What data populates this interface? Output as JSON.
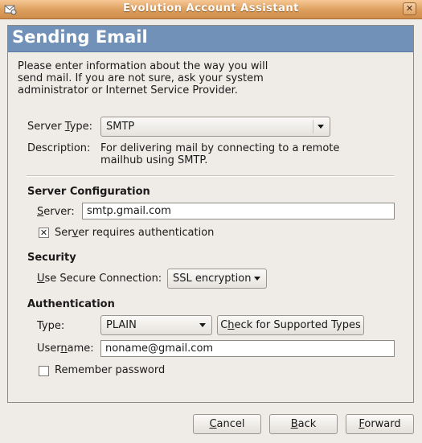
{
  "window": {
    "title": "Evolution Account Assistant",
    "close_glyph": "✕"
  },
  "page": {
    "heading": "Sending Email",
    "intro": "Please enter information about the way you will send mail. If you are not sure, ask your system administrator or Internet Service Provider."
  },
  "server_type": {
    "label_pre": "Server ",
    "label_key": "T",
    "label_post": "ype:",
    "value": "SMTP",
    "description_label": "Description:",
    "description_line1": "For delivering mail by connecting to a remote",
    "description_line2": "mailhub using SMTP."
  },
  "server_config": {
    "heading": "Server Configuration",
    "server_label_key": "S",
    "server_label_post": "erver:",
    "server_value": "smtp.gmail.com",
    "auth_required_checked": true,
    "auth_required_pre": "Ser",
    "auth_required_key": "v",
    "auth_required_post": "er requires authentication"
  },
  "security": {
    "heading": "Security",
    "secure_label_key": "U",
    "secure_label_post": "se Secure Connection:",
    "secure_value": "SSL encryption"
  },
  "authentication": {
    "heading": "Authentication",
    "type_label": "Type:",
    "type_value": "PLAIN",
    "check_pre": "C",
    "check_key": "h",
    "check_post": "eck for Supported Types",
    "username_pre": "User",
    "username_key": "n",
    "username_post": "ame:",
    "username_value": "noname@gmail.com",
    "remember_checked": false,
    "remember_label": "Remember password"
  },
  "footer": {
    "cancel_key": "C",
    "cancel_post": "ancel",
    "back_key": "B",
    "back_post": "ack",
    "forward_key": "F",
    "forward_post": "orward"
  },
  "colors": {
    "header_bg": "#7191b8",
    "titlebar": "#dc9e5c"
  },
  "icons": {
    "app": "evolution-mail-icon",
    "combo": "chevron-down-icon",
    "check": "checkmark-icon"
  }
}
